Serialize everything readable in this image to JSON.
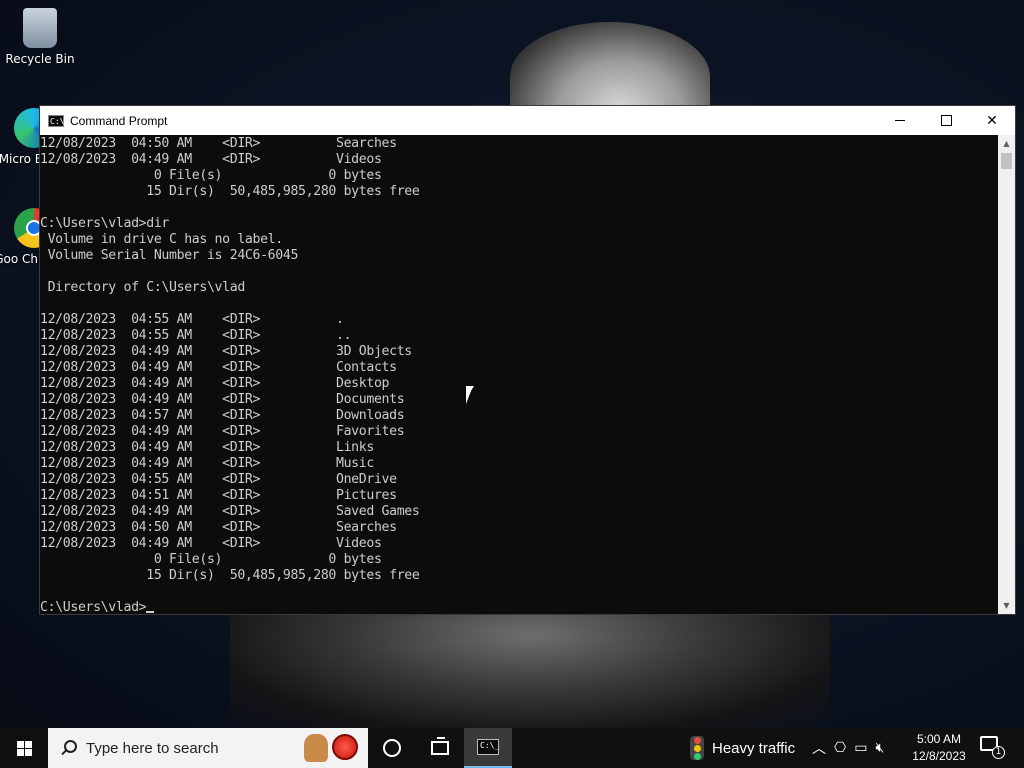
{
  "desktop": {
    "icons": [
      {
        "label": "Recycle Bin",
        "icon": "recycle-bin-icon"
      },
      {
        "label": "Micro Ed",
        "icon": "edge-icon"
      },
      {
        "label": "Goo Chro",
        "icon": "chrome-icon"
      }
    ]
  },
  "window": {
    "title": "Command Prompt",
    "controls": {
      "minimize": "minimize",
      "maximize": "maximize",
      "close": "close"
    },
    "console_lines": [
      "12/08/2023  04:50 AM    <DIR>          Searches",
      "12/08/2023  04:49 AM    <DIR>          Videos",
      "               0 File(s)              0 bytes",
      "              15 Dir(s)  50,485,985,280 bytes free",
      "",
      "C:\\Users\\vlad>dir",
      " Volume in drive C has no label.",
      " Volume Serial Number is 24C6-6045",
      "",
      " Directory of C:\\Users\\vlad",
      "",
      "12/08/2023  04:55 AM    <DIR>          .",
      "12/08/2023  04:55 AM    <DIR>          ..",
      "12/08/2023  04:49 AM    <DIR>          3D Objects",
      "12/08/2023  04:49 AM    <DIR>          Contacts",
      "12/08/2023  04:49 AM    <DIR>          Desktop",
      "12/08/2023  04:49 AM    <DIR>          Documents",
      "12/08/2023  04:57 AM    <DIR>          Downloads",
      "12/08/2023  04:49 AM    <DIR>          Favorites",
      "12/08/2023  04:49 AM    <DIR>          Links",
      "12/08/2023  04:49 AM    <DIR>          Music",
      "12/08/2023  04:55 AM    <DIR>          OneDrive",
      "12/08/2023  04:51 AM    <DIR>          Pictures",
      "12/08/2023  04:49 AM    <DIR>          Saved Games",
      "12/08/2023  04:50 AM    <DIR>          Searches",
      "12/08/2023  04:49 AM    <DIR>          Videos",
      "               0 File(s)              0 bytes",
      "              15 Dir(s)  50,485,985,280 bytes free",
      ""
    ],
    "prompt": "C:\\Users\\vlad>"
  },
  "taskbar": {
    "search_placeholder": "Type here to search",
    "news_text": "Heavy traffic",
    "clock_time": "5:00 AM",
    "clock_date": "12/8/2023",
    "notification_count": "1"
  },
  "colors": {
    "console_bg": "#0c0c0c",
    "console_text": "#cccccc",
    "taskbar_bg": "#101010",
    "accent": "#76b9ed"
  }
}
